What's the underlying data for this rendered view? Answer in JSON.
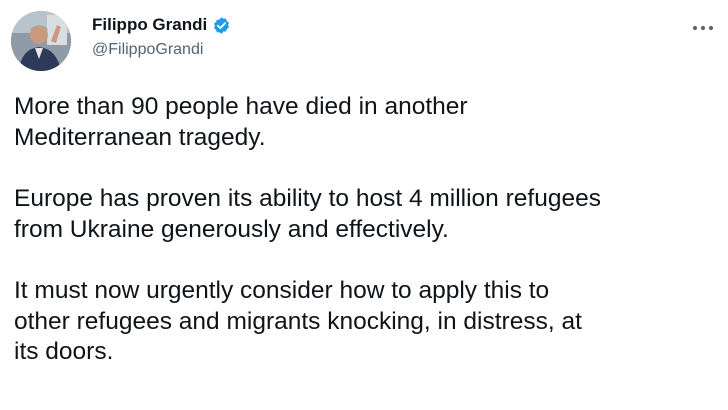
{
  "author": {
    "name": "Filippo Grandi",
    "handle": "@FilippoGrandi",
    "verified": true,
    "verified_color": "#1d9bf0"
  },
  "more_icon": "more-horizontal-icon",
  "tweet": {
    "paragraphs": [
      "More than 90 people have died in another\nMediterranean tragedy.",
      "Europe has proven its ability to host 4 million refugees\nfrom Ukraine generously and effectively.",
      "It must now urgently consider how to apply this to\nother refugees and migrants knocking, in distress, at\nits doors."
    ]
  }
}
